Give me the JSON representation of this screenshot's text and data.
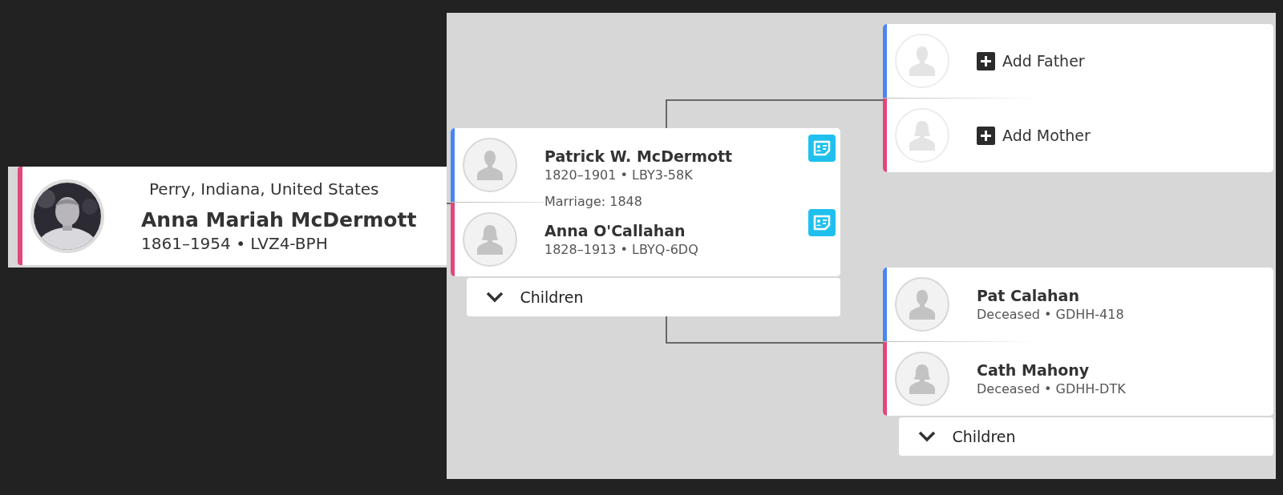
{
  "focus_person": {
    "place": "Perry, Indiana, United States",
    "name": "Anna Mariah McDermott",
    "details": "1861–1954 • LVZ4-BPH",
    "female": true
  },
  "parents": {
    "members": [
      {
        "kind": "person",
        "female": false,
        "name": "Patrick W. McDermott",
        "details": "1820–1901 • LBY3-58K",
        "has_record": true
      },
      {
        "kind": "person",
        "female": true,
        "name": "Anna O'Callahan",
        "details": "1828–1913 • LBYQ-6DQ",
        "has_record": true
      }
    ],
    "marriage": "Marriage: 1848",
    "children_label": "Children"
  },
  "grandparents": [
    {
      "members": [
        {
          "kind": "add",
          "female": false,
          "label": "Add Father"
        },
        {
          "kind": "add",
          "female": true,
          "label": "Add Mother"
        }
      ]
    },
    {
      "members": [
        {
          "kind": "person",
          "female": false,
          "name": "Pat Calahan",
          "details": "Deceased • GDHH-418",
          "has_record": false
        },
        {
          "kind": "person",
          "female": true,
          "name": "Cath Mahony",
          "details": "Deceased • GDHH-DTK",
          "has_record": false
        }
      ],
      "children_label": "Children"
    }
  ]
}
